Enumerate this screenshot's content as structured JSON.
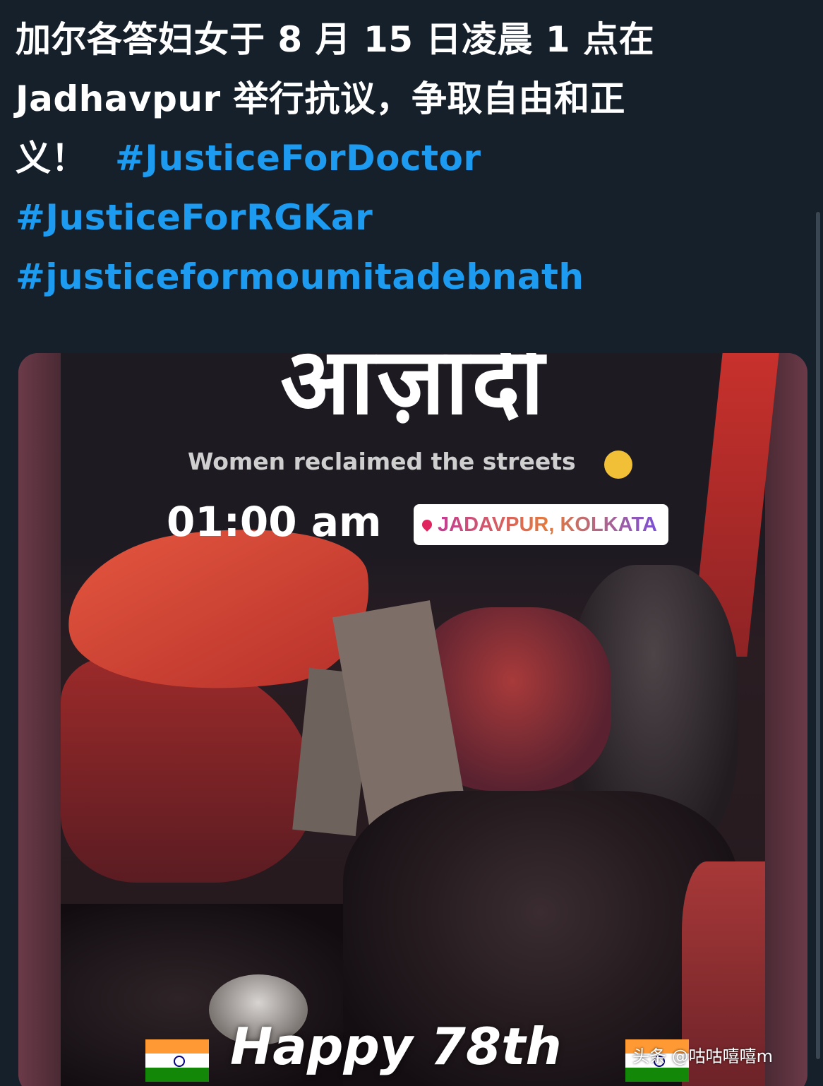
{
  "tweet": {
    "text_line1": "加尔各答妇女于 8 月 15 日凌晨 1 点在",
    "text_line2": "Jadhavpur 举行抗议，争取自由和正",
    "text_line3": "义！",
    "hashtags": [
      "#JusticeForDoctor",
      "#JusticeForRGKar",
      "#justiceformoumitadebnath"
    ],
    "hashtag_color": "#1d9bf0",
    "text_color": "#ffffff",
    "background_color": "#15202b"
  },
  "media": {
    "title": "आज़ादी",
    "subtitle": "Women reclaimed the streets",
    "subtitle_icon": "raised-fist-icon",
    "time": "01:00 am",
    "location_icon": "location-pin-icon",
    "location": "JADAVPUR, KOLKATA",
    "footer_text": "Happy 78th",
    "flag_icon": "india-flag-icon",
    "watermark": "头条 @咕咕嘻嘻m"
  }
}
